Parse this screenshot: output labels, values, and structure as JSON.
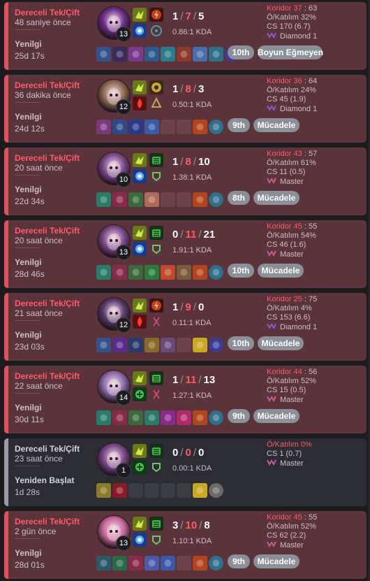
{
  "colors": {
    "loss_bg": "#5b343b",
    "loss_accent": "#e0525e",
    "remake_bg": "#2c2c33",
    "remake_accent": "#9a9aa4",
    "badge": "#8a8f98"
  },
  "labels": {
    "pk": "Koridor",
    "kp": "Ö/Katılım",
    "cs": "CS",
    "kda_suffix": "KDA"
  },
  "matches": [
    {
      "queue": "Dereceli Tek/Çift",
      "ago": "48 saniye önce",
      "result": "Yenilgi",
      "duration": "25d 17s",
      "remake": false,
      "champ_color": "#6b2f8c",
      "level": "13",
      "kills": "1",
      "deaths": "7",
      "assists": "5",
      "kda_ratio": "0.86:1 KDA",
      "pk_value": "37",
      "pk_pct": "63",
      "kp": "Ö/Katılım 32%",
      "cs": "CS 170 (6.7)",
      "rank": "Diamond 1",
      "rank_icon": "diamond",
      "spells": [
        "ghost",
        "flash"
      ],
      "runes": [
        "electrocute",
        "sorcery"
      ],
      "items": [
        "#36528c",
        "#3a2a5c",
        "#7a3a8c",
        "#2c5a8c",
        "#2c7a8a",
        "#8c3a2c",
        "#4a6ea8",
        "#2f6f88",
        "#3b3b9a"
      ],
      "badges": [
        {
          "text": "10th",
          "w": 38
        },
        {
          "text": "Boyun Eğmeyen",
          "w": 93
        }
      ]
    },
    {
      "queue": "Dereceli Tek/Çift",
      "ago": "36 dakika önce",
      "result": "Yenilgi",
      "duration": "24d 12s",
      "remake": false,
      "champ_color": "#8a6a50",
      "level": "12",
      "kills": "1",
      "deaths": "8",
      "assists": "3",
      "kda_ratio": "0.50:1 KDA",
      "pk_value": "36",
      "pk_pct": "64",
      "kp": "Ö/Katılım 24%",
      "cs": "CS 45 (1.9)",
      "rank": "Diamond 1",
      "rank_icon": "diamond",
      "spells": [
        "ghost",
        "ignite"
      ],
      "runes": [
        "conqueror",
        "precision"
      ],
      "items": [
        "#7a3a7a",
        "#2c4a8c",
        "#2a3a8a",
        "#3a5aa8",
        "empty",
        "empty",
        "#b0451e",
        "#2f6f88"
      ],
      "badges": [
        {
          "text": "9th",
          "w": 32
        },
        {
          "text": "Mücadele",
          "w": 66
        }
      ]
    },
    {
      "queue": "Dereceli Tek/Çift",
      "ago": "20 saat önce",
      "result": "Yenilgi",
      "duration": "22d 34s",
      "remake": false,
      "champ_color": "#7a4a8a",
      "level": "10",
      "kills": "1",
      "deaths": "8",
      "assists": "10",
      "kda_ratio": "1.38:1 KDA",
      "pk_value": "43",
      "pk_pct": "57",
      "kp": "Ö/Katılım 61%",
      "cs": "CS 11 (0.5)",
      "rank": "Master",
      "rank_icon": "master",
      "spells": [
        "ghost",
        "flash"
      ],
      "runes": [
        "aftershock",
        "resolve"
      ],
      "items": [
        "#2a7a6a",
        "#8a2a4a",
        "#3a6a3a",
        "#b06a5a",
        "empty",
        "empty",
        "#b0451e",
        "#2f6f88"
      ],
      "badges": [
        {
          "text": "8th",
          "w": 32
        },
        {
          "text": "Mücadele",
          "w": 66
        }
      ]
    },
    {
      "queue": "Dereceli Tek/Çift",
      "ago": "20 saat önce",
      "result": "Yenilgi",
      "duration": "28d 46s",
      "remake": false,
      "champ_color": "#7a4a8a",
      "level": "13",
      "kills": "0",
      "deaths": "11",
      "assists": "21",
      "kda_ratio": "1.91:1 KDA",
      "pk_value": "45",
      "pk_pct": "55",
      "kp": "Ö/Katılım 54%",
      "cs": "CS 46 (1.6)",
      "rank": "Master",
      "rank_icon": "master",
      "spells": [
        "ghost",
        "flash"
      ],
      "runes": [
        "aftershock",
        "resolve"
      ],
      "items": [
        "#2a7a6a",
        "#8a2a4a",
        "#3a6a3a",
        "#2a7a3a",
        "#c04a2a",
        "#7a5a3a",
        "#b0451e",
        "#2f6f88"
      ],
      "badges": [
        {
          "text": "10th",
          "w": 38
        },
        {
          "text": "Mücadele",
          "w": 66
        }
      ]
    },
    {
      "queue": "Dereceli Tek/Çift",
      "ago": "21 saat önce",
      "result": "Yenilgi",
      "duration": "23d 03s",
      "remake": false,
      "champ_color": "#5a3a6a",
      "level": "12",
      "kills": "1",
      "deaths": "9",
      "assists": "0",
      "kda_ratio": "0.11:1 KDA",
      "pk_value": "25",
      "pk_pct": "75",
      "kp": "Ö/Katılım 4%",
      "cs": "CS 153 (6.6)",
      "rank": "Diamond 1",
      "rank_icon": "diamond",
      "spells": [
        "ghost",
        "ignite"
      ],
      "runes": [
        "electrocute",
        "domination"
      ],
      "items": [
        "#36528c",
        "#5a2a8c",
        "#2a3a6a",
        "#8a6a2a",
        "#6a4a7a",
        "empty",
        "#c8a820",
        "#3b3b9a"
      ],
      "badges": [
        {
          "text": "10th",
          "w": 38
        },
        {
          "text": "Mücadele",
          "w": 66
        }
      ]
    },
    {
      "queue": "Dereceli Tek/Çift",
      "ago": "22 saat önce",
      "result": "Yenilgi",
      "duration": "30d 11s",
      "remake": false,
      "champ_color": "#8a6aa8",
      "level": "14",
      "kills": "1",
      "deaths": "11",
      "assists": "13",
      "kda_ratio": "1.27:1 KDA",
      "pk_value": "44",
      "pk_pct": "56",
      "kp": "Ö/Katılım 52%",
      "cs": "CS 15 (0.5)",
      "rank": "Master",
      "rank_icon": "master",
      "spells": [
        "ghost",
        "heal"
      ],
      "runes": [
        "aftershock",
        "domination"
      ],
      "items": [
        "#2a7a6a",
        "#8a2a4a",
        "#3a6a3a",
        "#2a7a6a",
        "#8a2a8a",
        "#b02a6a",
        "#b0451e",
        "#2f6f88"
      ],
      "badges": [
        {
          "text": "9th",
          "w": 32
        },
        {
          "text": "Mücadele",
          "w": 66
        }
      ]
    },
    {
      "queue": "Dereceli Tek/Çift",
      "ago": "23 saat önce",
      "result": "Yeniden Başlat",
      "duration": "1d 28s",
      "remake": true,
      "champ_color": "#7a4a8a",
      "level": "1",
      "kills": "0",
      "deaths": "0",
      "assists": "0",
      "kda_ratio": "0.00:1 KDA",
      "pk_value": "",
      "pk_pct": "",
      "kp": "Ö/Katılım 0%",
      "cs": "CS 1 (0.7)",
      "rank": "Master",
      "rank_icon": "master",
      "spells": [
        "ghost",
        "heal"
      ],
      "runes": [
        "aftershock",
        "resolve"
      ],
      "items": [
        "#8a7a2a",
        "#8a1a2a",
        "empty",
        "empty",
        "empty",
        "empty",
        "#c8a820",
        "#6a6a6a"
      ],
      "badges": []
    },
    {
      "queue": "Dereceli Tek/Çift",
      "ago": "2 gün önce",
      "result": "Yenilgi",
      "duration": "28d 01s",
      "remake": false,
      "champ_color": "#c86a9a",
      "level": "13",
      "kills": "3",
      "deaths": "10",
      "assists": "8",
      "kda_ratio": "1.10:1 KDA",
      "pk_value": "45",
      "pk_pct": "55",
      "kp": "Ö/Katılım 52%",
      "cs": "CS 62 (2.2)",
      "rank": "Master",
      "rank_icon": "master",
      "spells": [
        "ghost",
        "flash"
      ],
      "runes": [
        "aftershock",
        "resolve"
      ],
      "items": [
        "#2a5a6a",
        "#2a6a4a",
        "#8a2a4a",
        "#4a5aa8",
        "#3a5aa8",
        "empty",
        "#b0451e",
        "#2f6f88"
      ],
      "badges": [
        {
          "text": "9th",
          "w": 32
        },
        {
          "text": "Mücadele",
          "w": 66
        }
      ]
    }
  ]
}
